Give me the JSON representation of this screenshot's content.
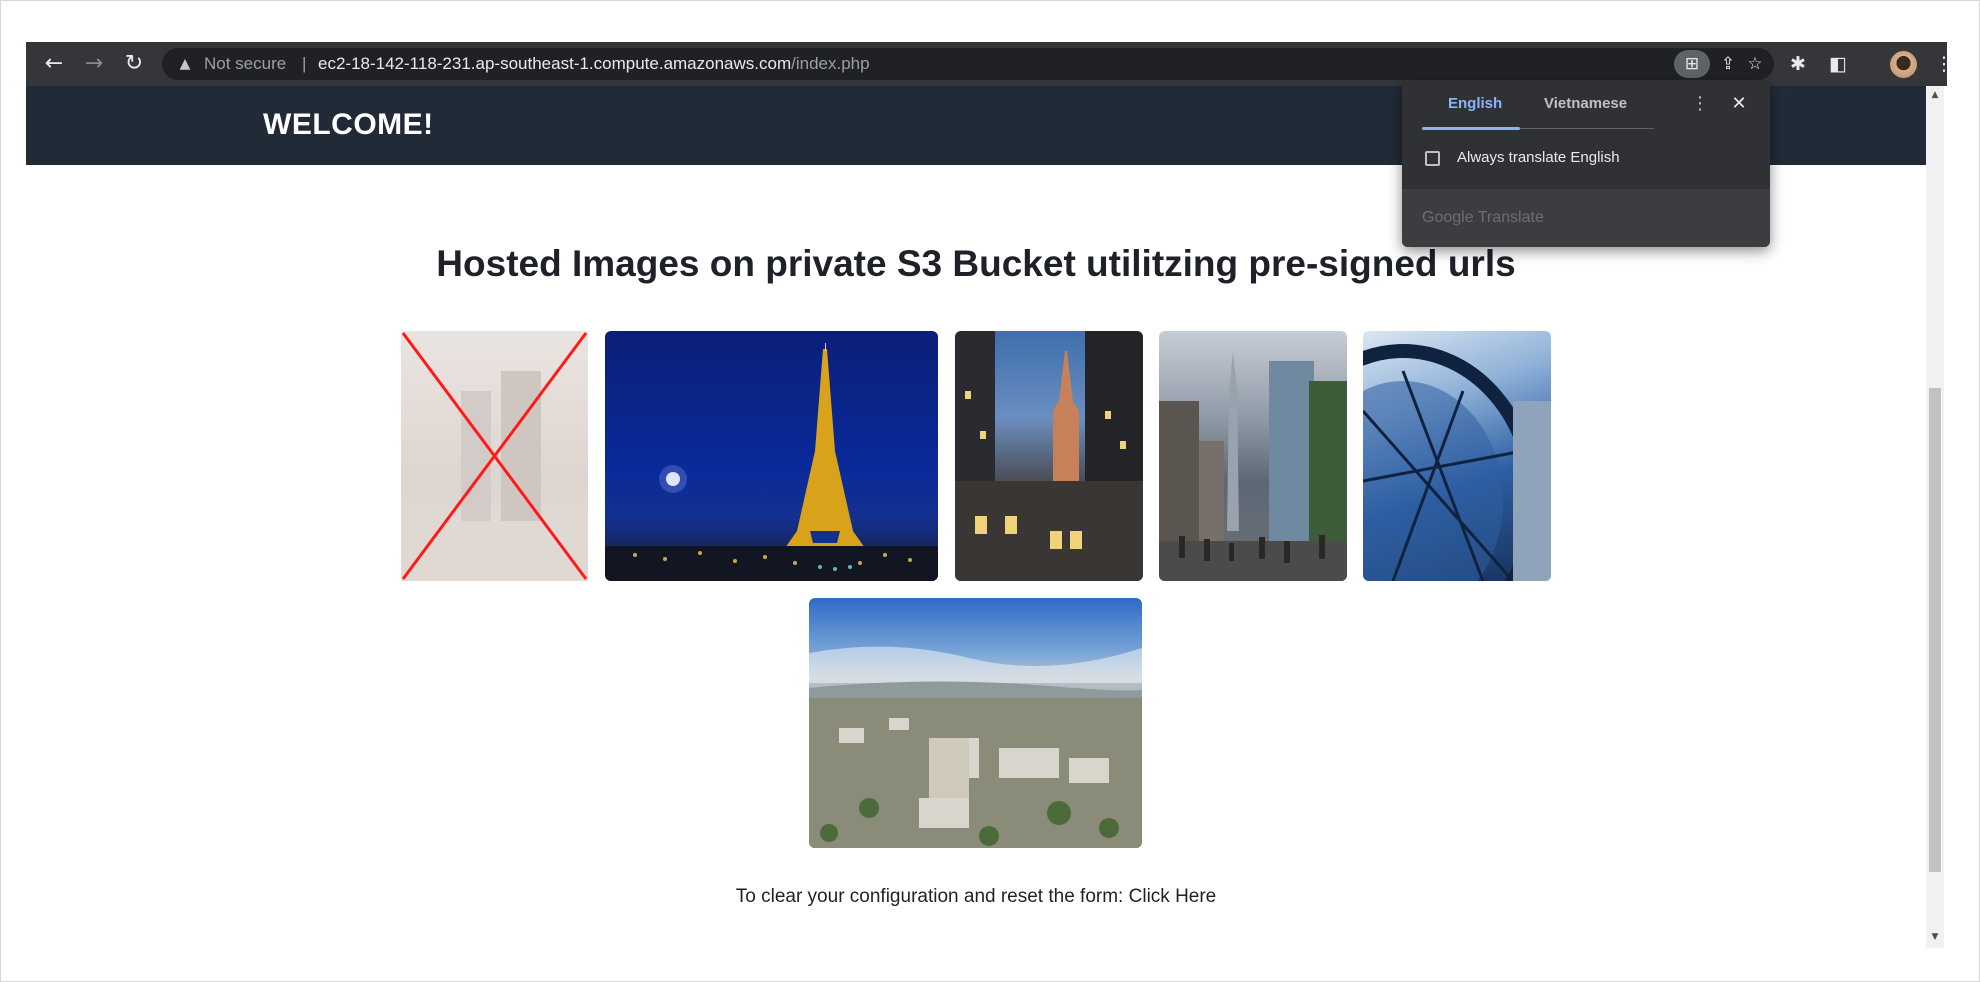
{
  "browser": {
    "security_label": "Not secure",
    "separator": "|",
    "url_host": "ec2-18-142-118-231.ap-southeast-1.compute.amazonaws.com",
    "url_path": "/index.php"
  },
  "site": {
    "welcome": "WELCOME!",
    "heading": "Hosted Images on private S3 Bucket utilitzing pre-signed urls",
    "footer_text": "To clear your configuration and reset the form: ",
    "footer_link": "Click Here"
  },
  "translate_popup": {
    "tabs": [
      "English",
      "Vietnamese"
    ],
    "active_tab": "English",
    "checkbox_label": "Always translate English",
    "checkbox_checked": false,
    "brand": "Google Translate"
  },
  "colors": {
    "header_bg": "#212a37",
    "chrome_bg": "#35363a",
    "accent": "#8ab4f8"
  }
}
